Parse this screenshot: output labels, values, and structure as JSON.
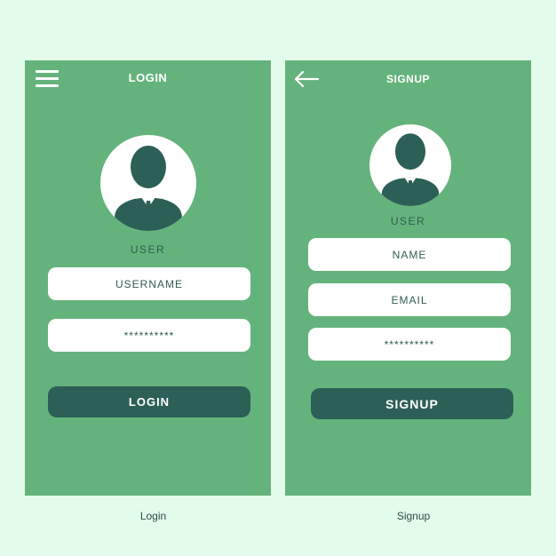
{
  "login": {
    "title": "LOGIN",
    "user_label": "USER",
    "username_field": "USERNAME",
    "password_field": "**********",
    "button_label": "LOGIN",
    "caption": "Login"
  },
  "signup": {
    "title": "SIGNUP",
    "user_label": "USER",
    "name_field": "NAME",
    "email_field": "EMAIL",
    "password_field": "**********",
    "button_label": "SIGNUP",
    "caption": "Signup"
  },
  "colors": {
    "background": "#e2fbeb",
    "panel": "#65b37c",
    "accent_dark": "#2c5f56",
    "field": "#ffffff"
  },
  "icons": [
    "hamburger-menu-icon",
    "back-arrow-icon",
    "user-avatar-icon"
  ]
}
